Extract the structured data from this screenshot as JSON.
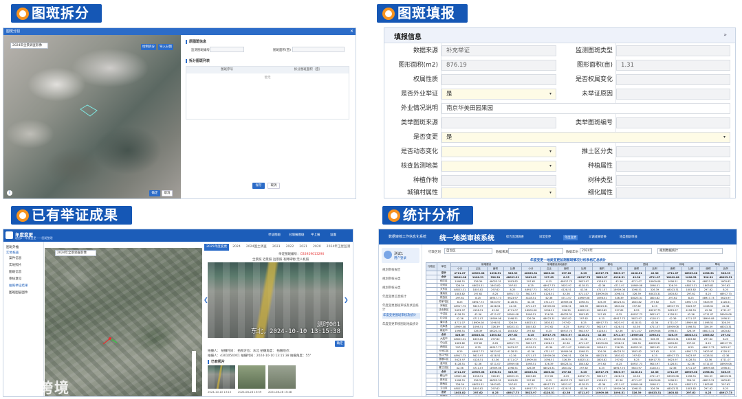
{
  "banners": {
    "b1": "图斑拆分",
    "b2": "图斑填报",
    "b3": "已有举证成果",
    "b4": "统计分析"
  },
  "panel1": {
    "window_title": "图斑分割",
    "close": "✕",
    "layer_select": "2024年全景调查影像",
    "btn_draw": "绘制拆分",
    "btn_import": "导入分割",
    "sec_original": "原图斑信息",
    "label_code": "监测图斑编号",
    "label_area": "图斑面积(亩)",
    "sec_split": "拆分图斑列表",
    "col1": "图斑序号",
    "col2": "拆分图斑面积（亩）",
    "nodata": "暂无",
    "btn_confirm": "确定",
    "btn_cancel": "取消",
    "btn_save": "保存",
    "btn_close": "取消",
    "info": "i"
  },
  "panel2": {
    "title": "填报信息",
    "collapse": "»",
    "rows": [
      {
        "l1": "数据来源",
        "v1": "补充举证",
        "l2": "监测图斑类型",
        "v2": ""
      },
      {
        "l1": "图形面积(m2)",
        "v1": "876.19",
        "l2": "图形面积(亩)",
        "v2": "1.31"
      },
      {
        "l1": "权属性质",
        "v1": "",
        "l2": "是否权属变化",
        "v2": ""
      },
      {
        "l1": "是否外业举证",
        "v1": "是",
        "l2": "未举证原因",
        "v2": ""
      },
      {
        "l1": "外业情况说明",
        "v1": "南京华美田园果园",
        "l2": "",
        "v2": ""
      },
      {
        "l1": "类举图斑来源",
        "v1": "",
        "l2": "类举图斑编号",
        "v2": ""
      },
      {
        "l1": "是否变更",
        "v1": "是",
        "l2": "",
        "v2": ""
      },
      {
        "l1": "是否动态变化",
        "v1": "",
        "l2": "推土区分类",
        "v2": ""
      },
      {
        "l1": "核查监测地类",
        "v1": "",
        "l2": "种植属性",
        "v2": ""
      },
      {
        "l1": "种植作物",
        "v1": "",
        "l2": "树种类型",
        "v2": ""
      },
      {
        "l1": "城镇村属性",
        "v1": "",
        "l2": "细化属性",
        "v2": ""
      }
    ],
    "dropdown": "▾"
  },
  "panel3": {
    "app_title": "年度变更",
    "app_subtitle": "理由2—年度变更——图斑整理",
    "nav": [
      "举证图斑",
      "已填报图斑",
      "平上报",
      "设置"
    ],
    "side": [
      "图斑外推",
      "实地核查",
      "案件信息",
      "实地照片",
      "图斑信息",
      "审核意见",
      "拍照举证结果",
      "图斑图层图件"
    ],
    "layer_select": "2024年全景调查影像",
    "tabs": [
      "2025年度变更",
      "2024",
      "2024国土调查",
      "2023",
      "2022",
      "2021",
      "2020",
      "2024年卫星监测",
      "2023",
      "2022",
      "2021"
    ],
    "pin_label": "举证图斑编号：",
    "pin_value": "CB3929013290",
    "pin_check": "同显示已举证照片",
    "filters": [
      "全景照",
      "近景照",
      "远景照",
      "有障碍物",
      "无人机照",
      "车载照"
    ],
    "photo_stamp_1": "测时001",
    "photo_stamp_2": "东北，2024-10-10 13:15:38",
    "info_line1": "拍摄人：  拍摄时间：  拍照方位：东北  拍摄角度：  拍摄地点：",
    "info_line2": "拍摄人：43010540X1  拍摄时间：2024-10-10 13:15:38  拍摄角度：55°",
    "btn_ok": "确定",
    "sec_photos": "已有照片",
    "thumb_dates": [
      "2024-10-10 13:15",
      "2024-08-28 15:59",
      "2024-08-28 15:48"
    ],
    "watermark": "大数跨境"
  },
  "panel4": {
    "app_title": "统一地类审核系统",
    "sub_logo": "数据审核工作信息化系统",
    "nav": [
      "综合监测调查",
      "日常变更",
      "年度变更",
      "三调成果转换",
      "地类图斑审核"
    ],
    "user_name": "测试1",
    "user_role": "用户登录",
    "side": [
      "规划审核报告",
      "规划审核分类",
      "规划审核分类",
      "年度变更信息统计",
      "年度变更图斑审核及状态统计",
      "年度变更图斑审核及统计",
      "年度变更审核图斑地类统计"
    ],
    "filter_label1": "行政区划",
    "filter_val1": "自治区",
    "filter_label2": "数据来源",
    "filter_label3": "数据年份",
    "filter_val3": "2024年",
    "filter_label4": "规划数据统计",
    "table_title": "年度变更—地类变更监测图斑情况分析表格汇总统计",
    "col_groups": [
      "新增建设",
      "新增建设用地面积",
      "新增农用地面积",
      "耕地",
      "园地",
      "林地",
      "草地",
      "新增建设用地面积"
    ],
    "row_groups": [
      "总计",
      "合计",
      "和平区",
      "沈河区",
      "大东区",
      "皇姑区",
      "铁西区",
      "苏家屯区",
      "浑南区",
      "沈北新区",
      "于洪区",
      "辽中区",
      "康平县",
      "法库县",
      "新民市",
      "合计",
      "大连市",
      "中山区",
      "西岗区",
      "沙河口区",
      "甘井子区",
      "旅顺口区",
      "金州区",
      "普兰店区",
      "合计",
      "鞍山市",
      "铁东区",
      "铁西区",
      "立山区",
      "合计",
      "抚顺市"
    ],
    "sample_values": [
      "4711.07",
      "18909.08",
      "1098.51",
      "326.39",
      "48023.31",
      "1803.82",
      "297.62",
      "8.25",
      "48917.73",
      "5623.97",
      "4128.51",
      "42.36"
    ]
  },
  "colors": {
    "brand_blue": "#1557b5",
    "accent_orange": "#f7931e",
    "nav_blue": "#1c5db9"
  }
}
